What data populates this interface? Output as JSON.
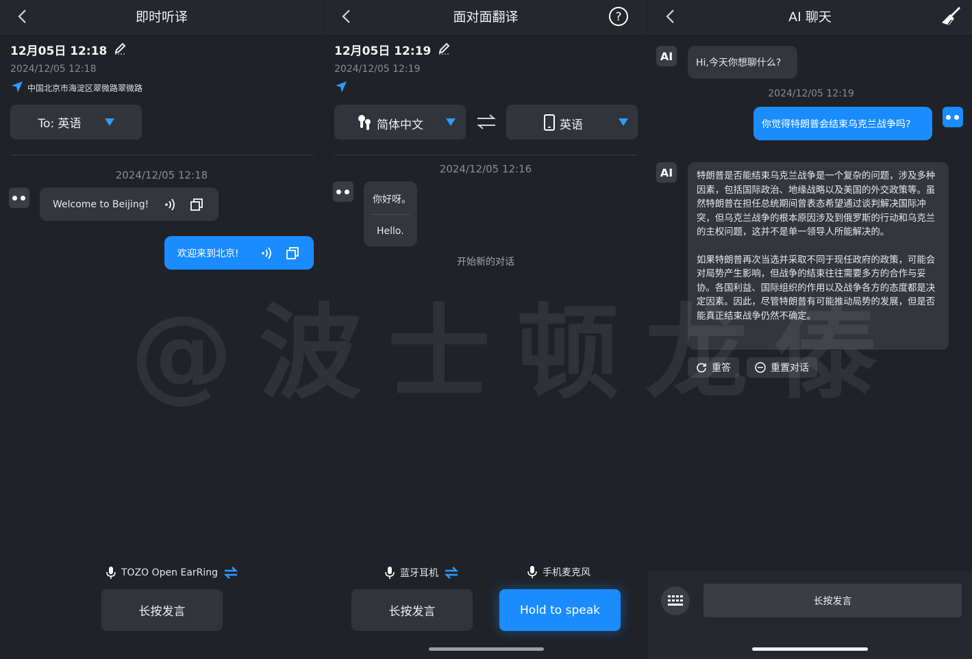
{
  "panel1": {
    "title": "即时听译",
    "date_main": "12月05日 12:18",
    "date_sub": "2024/12/05 12:18",
    "location": "中国北京市海淀区翠微路翠微路",
    "target_lang": "To: 英语",
    "chat_time": "2024/12/05 12:18",
    "msg_in": "Welcome to Beijing!",
    "msg_out": "欢迎来到北京!",
    "device": "TOZO Open EarRing",
    "hold_button": "长按发言"
  },
  "panel2": {
    "title": "面对面翻译",
    "date_main": "12月05日 12:19",
    "date_sub": "2024/12/05 12:19",
    "lang_left": "简体中文",
    "lang_right": "英语",
    "chat_time": "2024/12/05 12:16",
    "msg_src": "你好呀。",
    "msg_trans": "Hello.",
    "new_conversation": "开始新的对话",
    "mic_left": "蓝牙耳机",
    "mic_right": "手机麦克风",
    "hold_left": "长按发言",
    "hold_right": "Hold to speak"
  },
  "panel3": {
    "title": "AI 聊天",
    "ai_label": "AI",
    "greeting": "Hi,今天你想聊什么?",
    "chat_time": "2024/12/05 12:19",
    "user_msg": "你觉得特朗普会结束乌克兰战争吗?",
    "answer_p1": "特朗普是否能结束乌克兰战争是一个复杂的问题，涉及多种因素，包括国际政治、地缘战略以及美国的外交政策等。虽然特朗普在担任总统期间曾表态希望通过谈判解决国际冲突，但乌克兰战争的根本原因涉及到俄罗斯的行动和乌克兰的主权问题，这并不是单一领导人所能解决的。",
    "answer_p2": "如果特朗普再次当选并采取不同于现任政府的政策，可能会对局势产生影响，但战争的结束往往需要多方的合作与妥协。各国利益、国际组织的作用以及战争各方的态度都是决定因素。因此，尽管特朗普有可能推动局势的发展，但是否能真正结束战争仍然不确定。",
    "retry": "重答",
    "reset": "重置对话",
    "hold_button": "长按发言"
  },
  "watermark": "@波士顿龙傣",
  "colors": {
    "accent": "#1a8cff",
    "bg": "#202228",
    "bubble": "#33363d"
  }
}
